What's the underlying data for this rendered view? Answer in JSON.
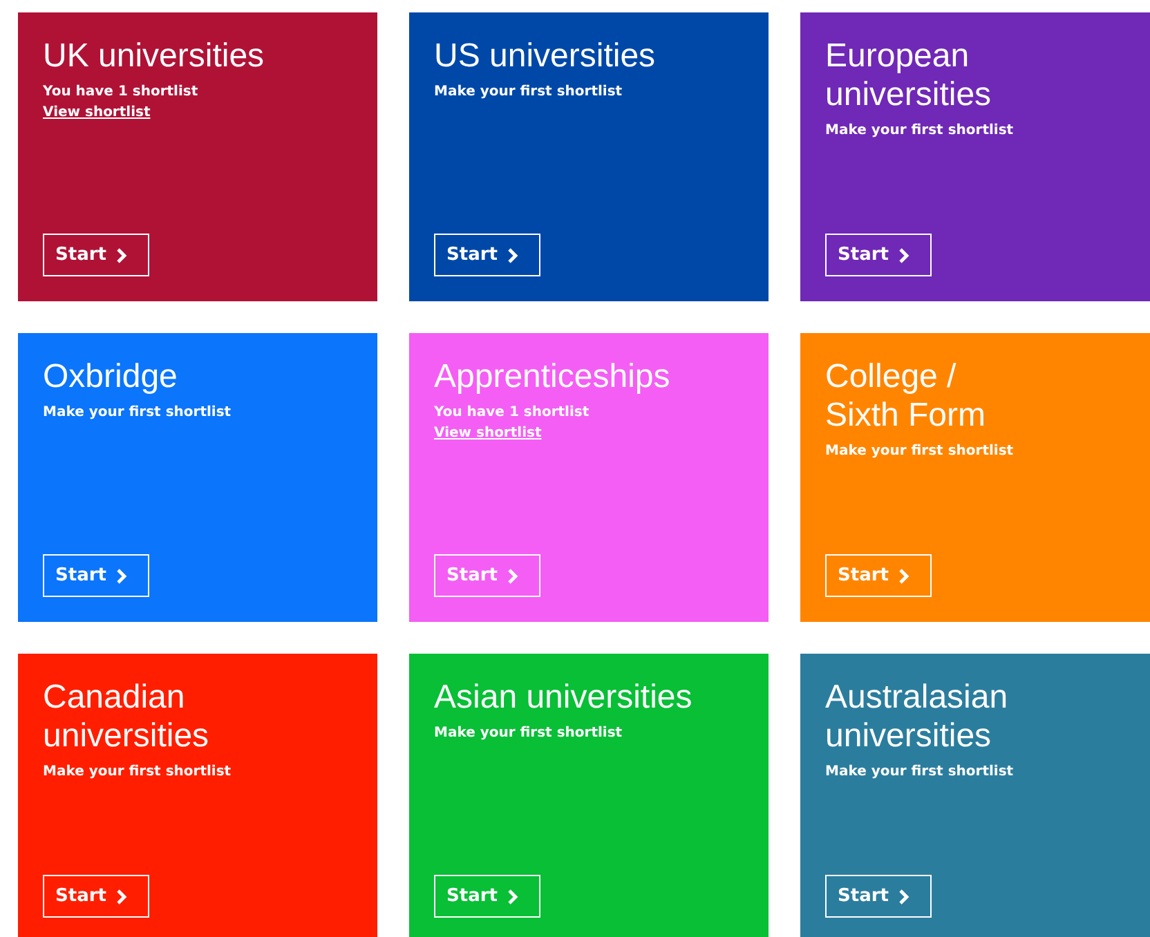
{
  "tiles": [
    {
      "title": "UK universities",
      "status": "You have 1 shortlist",
      "link": "View shortlist",
      "button": "Start",
      "color": "#b01236"
    },
    {
      "title": "US universities",
      "status": "Make your first shortlist",
      "button": "Start",
      "color": "#0048a8"
    },
    {
      "title": "European\nuniversities",
      "status": "Make your first shortlist",
      "button": "Start",
      "color": "#7028b6"
    },
    {
      "title": "Oxbridge",
      "status": "Make your first shortlist",
      "button": "Start",
      "color": "#0b75fb"
    },
    {
      "title": "Apprenticeships",
      "status": "You have 1 shortlist",
      "link": "View shortlist",
      "button": "Start",
      "color": "#f45ef4"
    },
    {
      "title": "College /\nSixth Form",
      "status": "Make your first shortlist",
      "button": "Start",
      "color": "#ff8500"
    },
    {
      "title": "Canadian\nuniversities",
      "status": "Make your first shortlist",
      "button": "Start",
      "color": "#ff1e00"
    },
    {
      "title": "Asian universities",
      "status": "Make your first shortlist",
      "button": "Start",
      "color": "#08bf36"
    },
    {
      "title": "Australasian\nuniversities",
      "status": "Make your first shortlist",
      "button": "Start",
      "color": "#2b7d9e"
    }
  ]
}
